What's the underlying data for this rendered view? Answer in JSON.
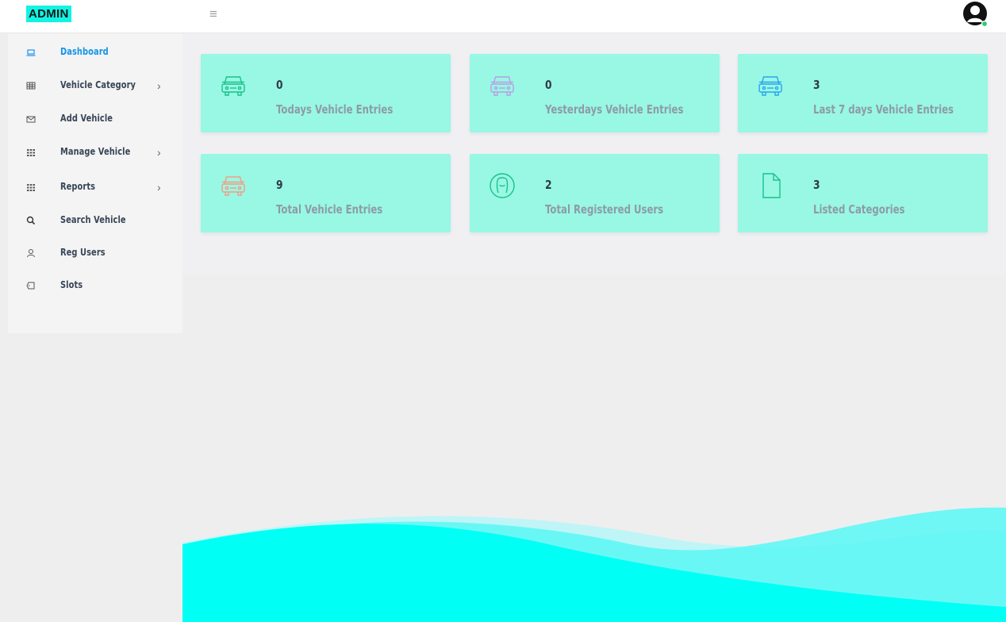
{
  "brand": {
    "label": "ADMIN"
  },
  "icons": {
    "menu": "hamburger-icon",
    "avatar": "user-avatar-icon"
  },
  "colors": {
    "brand_bg": "#12f3e4",
    "card_bg": "#98f8e3",
    "active": "#1694e8",
    "wave": "#00fff4",
    "online": "#2ecc71"
  },
  "sidebar": {
    "items": [
      {
        "label": "Dashboard",
        "icon": "laptop-icon",
        "active": true
      },
      {
        "label": "Vehicle Category",
        "icon": "table-icon",
        "chevron": true
      },
      {
        "label": "Add Vehicle",
        "icon": "envelope-icon"
      },
      {
        "label": "Manage Vehicle",
        "icon": "grid-icon",
        "chevron": true
      },
      {
        "label": "Reports",
        "icon": "grid-icon",
        "chevron": true
      },
      {
        "label": "Search Vehicle",
        "icon": "search-icon"
      },
      {
        "label": "Reg Users",
        "icon": "user-icon"
      },
      {
        "label": "Slots",
        "icon": "tag-icon"
      }
    ]
  },
  "cards": [
    {
      "value": "0",
      "label": "Todays Vehicle Entries",
      "icon": "car-icon",
      "icon_color": "#19c18a"
    },
    {
      "value": "0",
      "label": "Yesterdays Vehicle Entries",
      "icon": "car-icon",
      "icon_color": "#b99ee6"
    },
    {
      "value": "3",
      "label": "Last 7 days Vehicle Entries",
      "icon": "car-icon",
      "icon_color": "#2aa3f0"
    },
    {
      "value": "9",
      "label": "Total Vehicle Entries",
      "icon": "car-icon",
      "icon_color": "#f59b86"
    },
    {
      "value": "2",
      "label": "Total Registered Users",
      "icon": "user-circle-icon",
      "icon_color": "#19c18a"
    },
    {
      "value": "3",
      "label": "Listed Categories",
      "icon": "file-icon",
      "icon_color": "#19c18a"
    }
  ]
}
